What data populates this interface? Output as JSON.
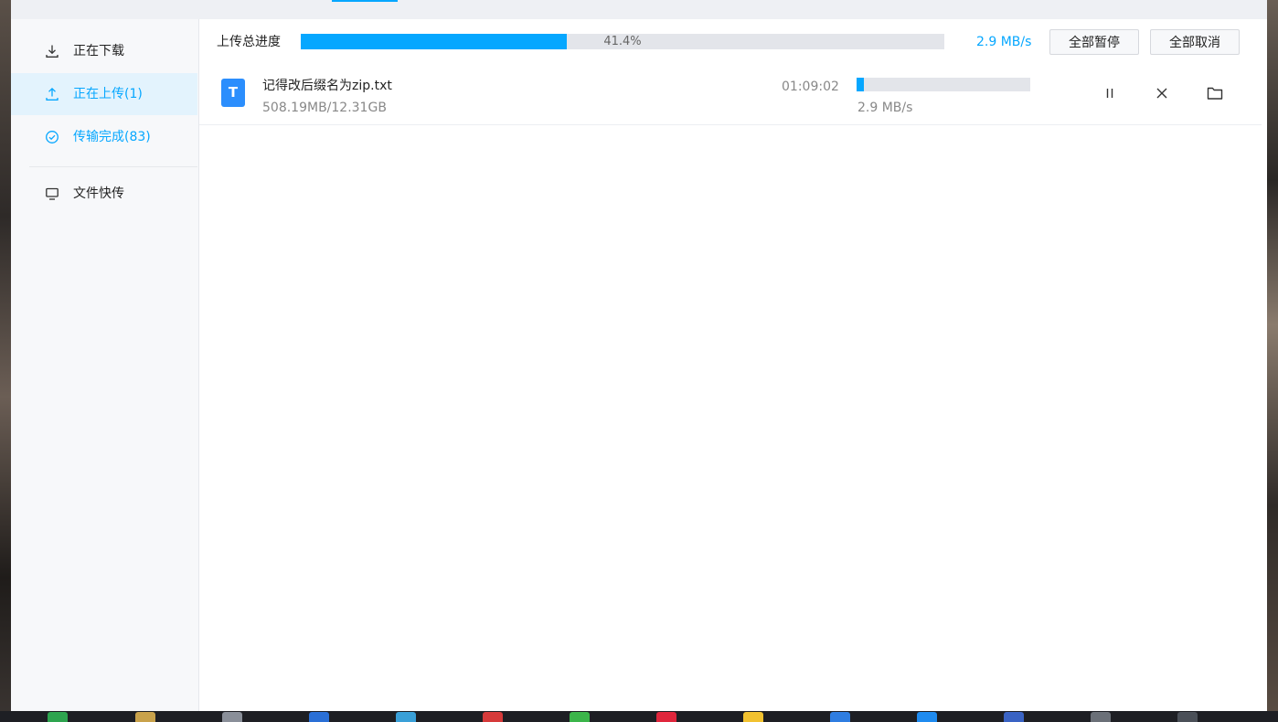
{
  "sidebar": {
    "items": [
      {
        "label": "正在下载",
        "icon": "download-icon"
      },
      {
        "label": "正在上传(1)",
        "icon": "upload-icon"
      },
      {
        "label": "传输完成(83)",
        "icon": "check-circle-icon"
      },
      {
        "label": "文件快传",
        "icon": "monitor-icon"
      }
    ],
    "active_index": 1
  },
  "overall": {
    "label": "上传总进度",
    "percent_text": "41.4%",
    "percent": 41.4,
    "speed": "2.9 MB/s",
    "pause_all_label": "全部暂停",
    "cancel_all_label": "全部取消"
  },
  "uploads": [
    {
      "type_letter": "T",
      "name": "记得改后缀名为zip.txt",
      "size": "508.19MB/12.31GB",
      "time_left": "01:09:02",
      "progress": 4.0,
      "speed": "2.9 MB/s",
      "actions": [
        "pause-icon",
        "close-icon",
        "folder-icon"
      ]
    }
  ],
  "colors": {
    "accent": "#06a7ff",
    "file_icon": "#2b8efd",
    "active_bg": "#e3f3fd",
    "track": "#e3e5ea"
  }
}
